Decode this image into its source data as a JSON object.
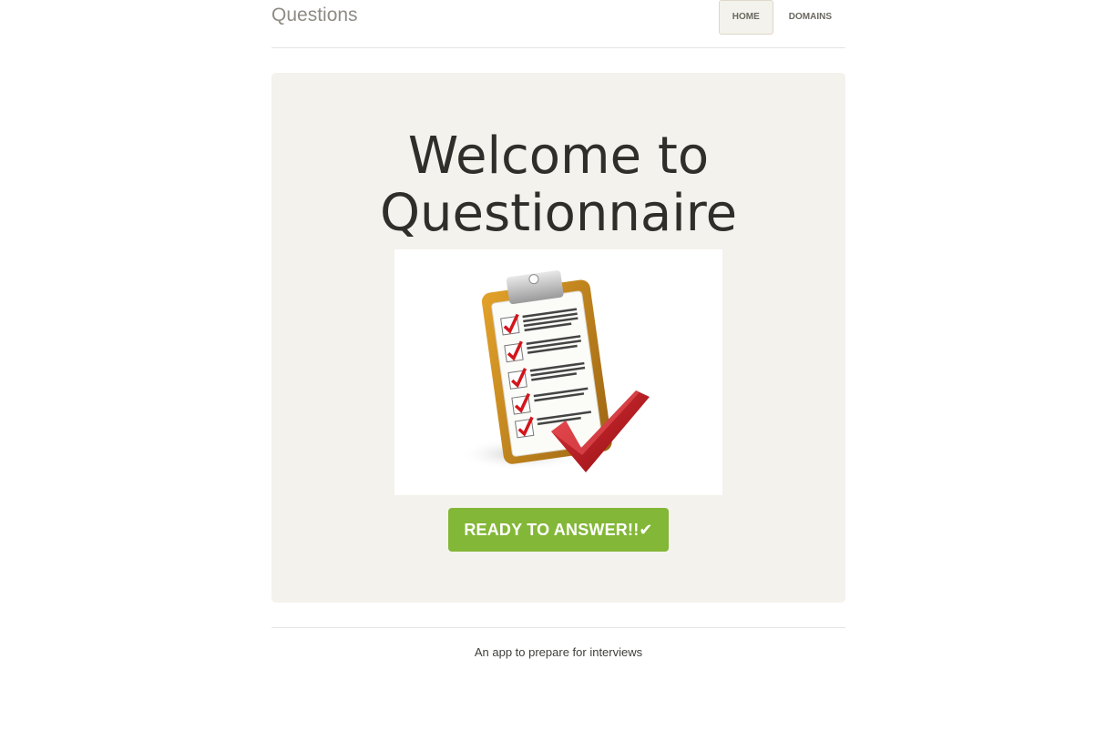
{
  "header": {
    "brand": "Questions",
    "nav": [
      {
        "label": "HOME",
        "active": true
      },
      {
        "label": "DOMAINS",
        "active": false
      }
    ]
  },
  "hero": {
    "title_line1": "Welcome to",
    "title_line2": "Questionnaire",
    "image_icon": "clipboard-checklist-icon",
    "cta_label": "READY TO ANSWER!!",
    "cta_icon_glyph": "✔"
  },
  "footer": {
    "text": "An app to prepare for interviews"
  },
  "colors": {
    "accent": "#83b737",
    "jumbotron_bg": "#f4f2ec",
    "brand_text": "#8e8c84",
    "checkmark_red": "#c8161d",
    "clipboard_brown": "#c98a1a"
  }
}
